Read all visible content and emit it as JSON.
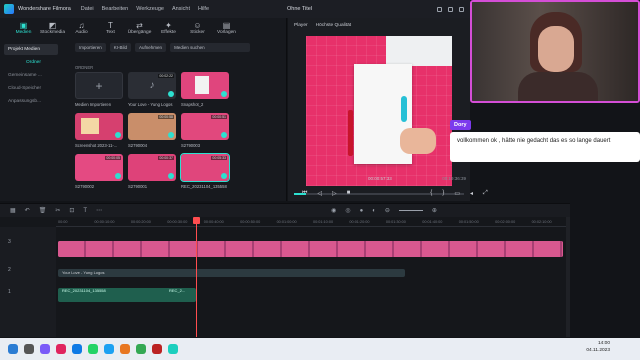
{
  "window": {
    "app_name": "Wondershare Filmora",
    "menu": [
      "Datei",
      "Bearbeiten",
      "Werkzeuge",
      "Ansicht",
      "Hilfe"
    ],
    "project_title": "Ohne Titel"
  },
  "toolbar": {
    "tools": [
      {
        "label": "Medien",
        "icon": "media-icon"
      },
      {
        "label": "Stockmedia",
        "icon": "stock-icon"
      },
      {
        "label": "Audio",
        "icon": "music-icon"
      },
      {
        "label": "Text",
        "icon": "text-icon"
      },
      {
        "label": "Übergänge",
        "icon": "transition-icon"
      },
      {
        "label": "Effekte",
        "icon": "effects-icon"
      },
      {
        "label": "Sticker",
        "icon": "sticker-icon"
      },
      {
        "label": "Vorlagen",
        "icon": "template-icon"
      }
    ]
  },
  "sidebar": {
    "items": [
      "Projekt Medien",
      "Ordner",
      "Gemeinsame ...",
      "Cloud-Speicher",
      "Anpassungsb..."
    ]
  },
  "mediabar": {
    "import_label": "Importieren",
    "ai_label": "KI-Bild",
    "record_label": "Aufnehmen",
    "search_placeholder": "Medien suchen"
  },
  "media": {
    "folder_label": "ORDNER",
    "items": [
      {
        "label": "Medien Importieren",
        "duration": ""
      },
      {
        "label": "Your Love - Yung Logos",
        "duration": "00:02:22"
      },
      {
        "label": "Snapshot_2",
        "duration": ""
      },
      {
        "label": "Screenshot 2023-11-...",
        "duration": ""
      },
      {
        "label": "S2790004",
        "duration": "00:00:58"
      },
      {
        "label": "S2790003",
        "duration": "00:00:51"
      },
      {
        "label": "S2790002",
        "duration": "00:00:05"
      },
      {
        "label": "S2790001",
        "duration": "00:00:37"
      },
      {
        "label": "REC_20231104_135558",
        "duration": "00:05:33"
      }
    ]
  },
  "player": {
    "tab": "Player",
    "quality": "Höchste Qualität",
    "current_time": "00:00:57:33",
    "total_time": "00:19:36:39"
  },
  "chat": {
    "name": "Dory",
    "message": "vollkommen ok , hätte nie gedacht das es so lange dauert"
  },
  "timeline": {
    "ruler": [
      "00:00",
      "00:00:10:00",
      "00:00:20:00",
      "00:00:30:00",
      "00:00:40:00",
      "00:00:50:00",
      "00:01:00:00",
      "00:01:10:00",
      "00:01:20:00",
      "00:01:30:00",
      "00:01:40:00",
      "00:01:50:00",
      "00:02:00:00",
      "00:02:10:00"
    ],
    "tracks": [
      {
        "label": "3"
      },
      {
        "label": "2"
      },
      {
        "label": "1"
      }
    ],
    "text_clip": "Your Love - Yung Logos",
    "audio_clip": "REC_20231104_135558",
    "audio_clip2": "REC_2..."
  },
  "taskbar": {
    "time": "14:00",
    "date": "04.11.2023"
  }
}
